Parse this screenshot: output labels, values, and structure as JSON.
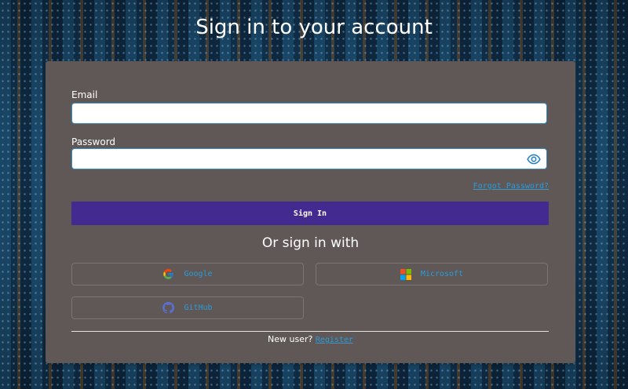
{
  "page": {
    "title": "Sign in to your account"
  },
  "form": {
    "email_label": "Email",
    "email_value": "",
    "password_label": "Password",
    "password_value": "",
    "forgot_password": "Forgot Password?",
    "sign_in_label": "Sign In"
  },
  "social": {
    "heading": "Or sign in with",
    "providers": [
      {
        "label": "Google",
        "icon": "google-icon"
      },
      {
        "label": "Microsoft",
        "icon": "microsoft-icon"
      },
      {
        "label": "GitHub",
        "icon": "github-icon"
      }
    ]
  },
  "footer": {
    "new_user_text": "New user?",
    "register_link": "Register"
  },
  "colors": {
    "card_background": "#5f5856",
    "primary_button": "#432a91",
    "link": "#2d9bd8",
    "input_border": "#3a8fc0"
  }
}
